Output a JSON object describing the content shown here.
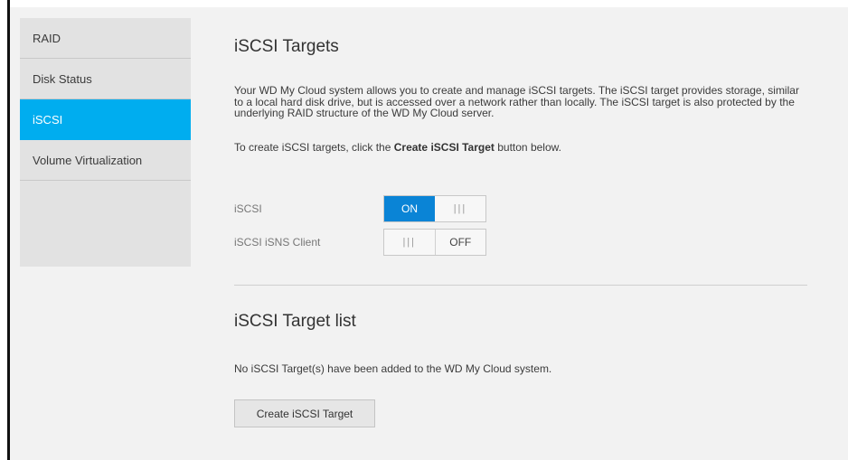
{
  "sidebar": {
    "items": [
      {
        "label": "RAID",
        "active": false
      },
      {
        "label": "Disk Status",
        "active": false
      },
      {
        "label": "iSCSI",
        "active": true
      },
      {
        "label": "Volume Virtualization",
        "active": false
      }
    ]
  },
  "main": {
    "title": "iSCSI Targets",
    "description": "Your WD My Cloud system allows you to create and manage iSCSI targets. The iSCSI target provides storage, similar to a local hard disk drive, but is accessed over a network rather than locally. The iSCSI target is also protected by the underlying RAID structure of the WD My Cloud server.",
    "hint_prefix": "To create iSCSI targets, click the ",
    "hint_bold": "Create iSCSI Target",
    "hint_suffix": " button below.",
    "settings": [
      {
        "label": "iSCSI",
        "state_label": "ON",
        "grip": "|||",
        "state": "on"
      },
      {
        "label": "iSCSI iSNS Client",
        "state_label": "OFF",
        "grip": "|||",
        "state": "off"
      }
    ],
    "list_title": "iSCSI Target list",
    "empty_message": "No iSCSI Target(s) have been added to the WD My Cloud system.",
    "create_button": "Create iSCSI Target"
  },
  "colors": {
    "accent": "#00adef",
    "toggle_on": "#0a84d6"
  }
}
